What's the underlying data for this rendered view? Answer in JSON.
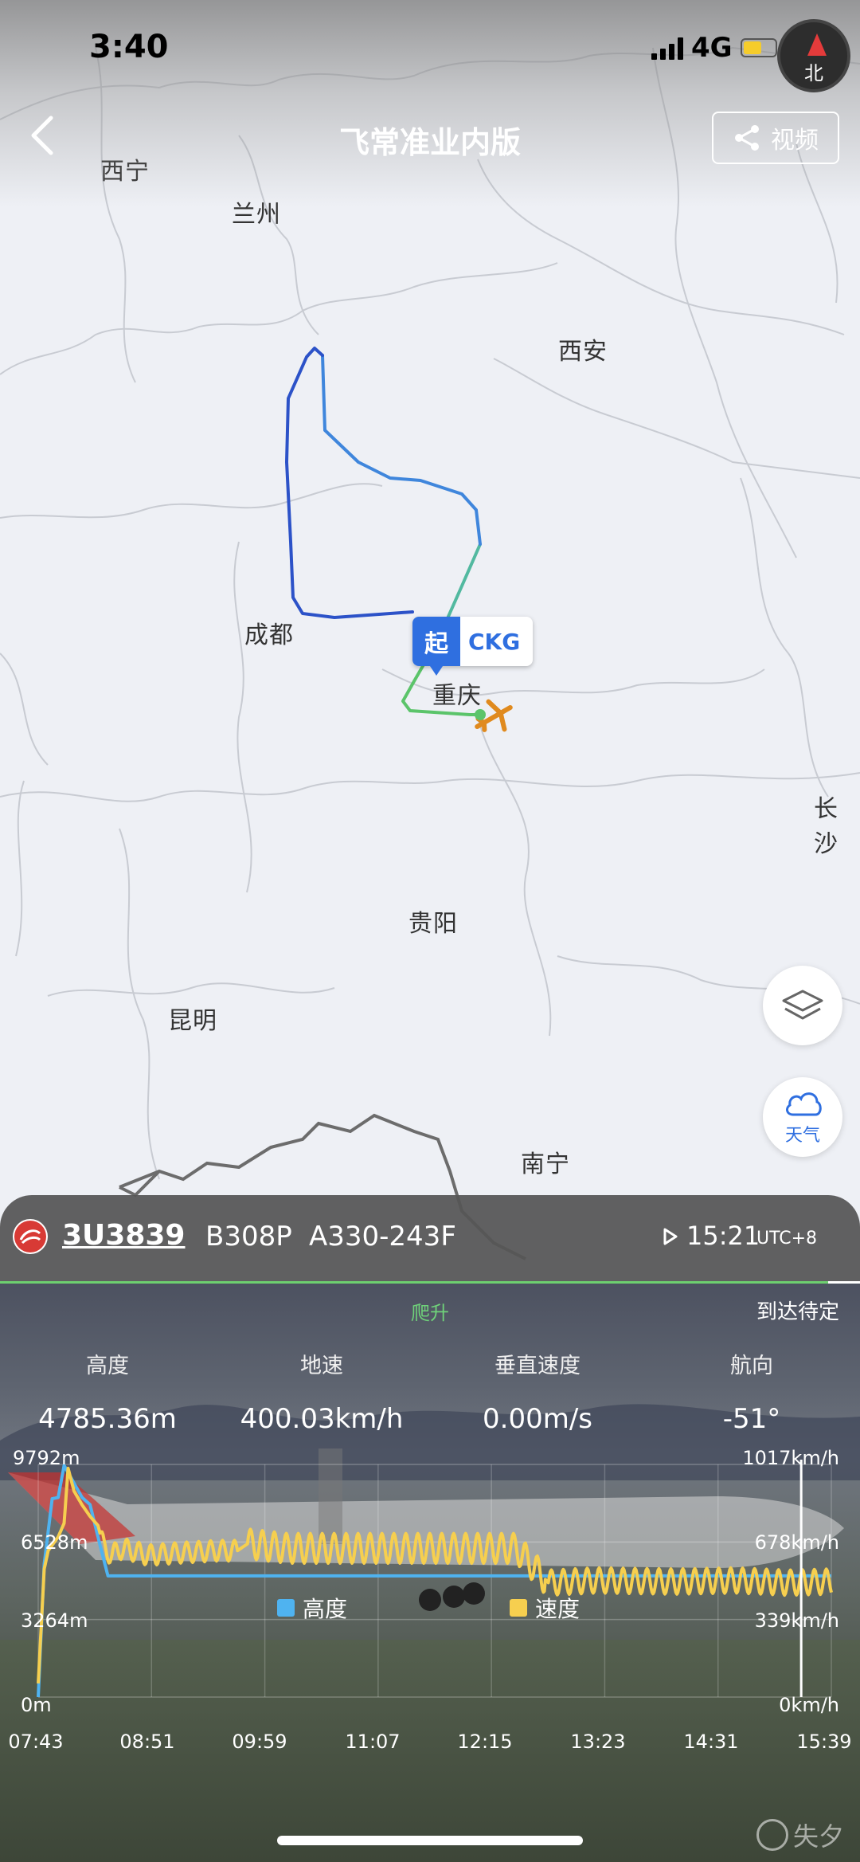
{
  "status_bar": {
    "time": "3:40",
    "network": "4G",
    "compass_label": "北"
  },
  "nav": {
    "title": "飞常准业内版",
    "share_label": "视频"
  },
  "map": {
    "cities": [
      {
        "name": "西宁",
        "id": "xining"
      },
      {
        "name": "兰州",
        "id": "lanzhou"
      },
      {
        "name": "西安",
        "id": "xian"
      },
      {
        "name": "成都",
        "id": "chengdu"
      },
      {
        "name": "重庆",
        "id": "chongqing"
      },
      {
        "name": "长沙",
        "id": "changsha"
      },
      {
        "name": "贵阳",
        "id": "guiyang"
      },
      {
        "name": "昆明",
        "id": "kunming"
      },
      {
        "name": "南宁",
        "id": "nanning"
      }
    ],
    "origin_marker": {
      "tag": "起",
      "code": "CKG"
    },
    "layers_icon": "layers-icon",
    "weather_label": "天气"
  },
  "flight": {
    "flight_no": "3U3839",
    "registration": "B308P",
    "aircraft_type": "A330-243F",
    "departure_time": "15:21",
    "timezone": "UTC+8"
  },
  "panel": {
    "phase": "爬升",
    "arrival_status": "到达待定",
    "stats": [
      {
        "label": "高度",
        "value": "4785.36m"
      },
      {
        "label": "地速",
        "value": "400.03km/h"
      },
      {
        "label": "垂直速度",
        "value": "0.00m/s"
      },
      {
        "label": "航向",
        "value": "-51°"
      }
    ]
  },
  "chart_data": {
    "type": "line",
    "x_ticks": [
      "07:43",
      "08:51",
      "09:59",
      "11:07",
      "12:15",
      "13:23",
      "14:31",
      "15:39"
    ],
    "y_left_ticks": [
      "9792m",
      "6528m",
      "3264m",
      "0m"
    ],
    "y_right_ticks": [
      "1017km/h",
      "678km/h",
      "339km/h",
      "0km/h"
    ],
    "y_left_range": [
      0,
      9792
    ],
    "y_right_range": [
      0,
      1017
    ],
    "series": [
      {
        "name": "高度",
        "color": "#4fb3f0",
        "axis": "left",
        "points": [
          [
            0,
            0
          ],
          [
            6,
            5600
          ],
          [
            14,
            8350
          ],
          [
            20,
            8400
          ],
          [
            26,
            9750
          ],
          [
            32,
            9300
          ],
          [
            44,
            8400
          ],
          [
            52,
            8100
          ],
          [
            62,
            6400
          ],
          [
            70,
            5100
          ],
          [
            200,
            5100
          ],
          [
            310,
            5100
          ],
          [
            440,
            5100
          ],
          [
            560,
            5100
          ],
          [
            640,
            5100
          ],
          [
            700,
            5100
          ],
          [
            752,
            5100
          ],
          [
            796,
            5100
          ]
        ]
      },
      {
        "name": "速度",
        "color": "#f6cf4f",
        "axis": "right",
        "points": [
          [
            0,
            60
          ],
          [
            6,
            560
          ],
          [
            10,
            640
          ],
          [
            20,
            700
          ],
          [
            26,
            760
          ],
          [
            30,
            1000
          ],
          [
            36,
            900
          ],
          [
            44,
            840
          ],
          [
            52,
            790
          ],
          [
            60,
            750
          ],
          [
            66,
            650
          ],
          [
            74,
            620
          ],
          [
            84,
            650
          ],
          [
            94,
            640
          ],
          [
            110,
            620
          ],
          [
            140,
            630
          ],
          [
            180,
            640
          ],
          [
            200,
            640
          ],
          [
            210,
            670
          ],
          [
            250,
            650
          ],
          [
            300,
            650
          ],
          [
            400,
            650
          ],
          [
            480,
            650
          ],
          [
            512,
            500
          ],
          [
            560,
            510
          ],
          [
            640,
            505
          ],
          [
            700,
            510
          ],
          [
            752,
            500
          ],
          [
            796,
            505
          ]
        ],
        "oscillation": [
          {
            "from": 62,
            "to": 200,
            "amplitude": 45,
            "period": 12
          },
          {
            "from": 210,
            "to": 508,
            "amplitude": 65,
            "period": 12
          },
          {
            "from": 512,
            "to": 796,
            "amplitude": 55,
            "period": 12
          }
        ]
      }
    ],
    "cursor_fraction": 0.962
  },
  "watermark": "失夕"
}
